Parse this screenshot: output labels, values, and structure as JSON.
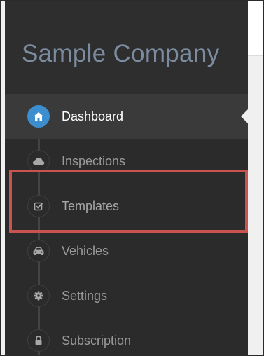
{
  "sidebar": {
    "brand": "Sample Company",
    "items": [
      {
        "label": "Dashboard",
        "icon": "home-icon",
        "active": true
      },
      {
        "label": "Inspections",
        "icon": "cloud-icon",
        "active": false
      },
      {
        "label": "Templates",
        "icon": "checkbox-icon",
        "active": false
      },
      {
        "label": "Vehicles",
        "icon": "car-icon",
        "active": false
      },
      {
        "label": "Settings",
        "icon": "gear-icon",
        "active": false
      },
      {
        "label": "Subscription",
        "icon": "lock-icon",
        "active": false
      }
    ]
  },
  "colors": {
    "sidebar_bg": "#2b2b2b",
    "active_item_bg": "#3a3a3a",
    "active_icon": "#3d8ecf",
    "brand_text": "#7c8ca0",
    "highlight_border": "#c9534f"
  }
}
